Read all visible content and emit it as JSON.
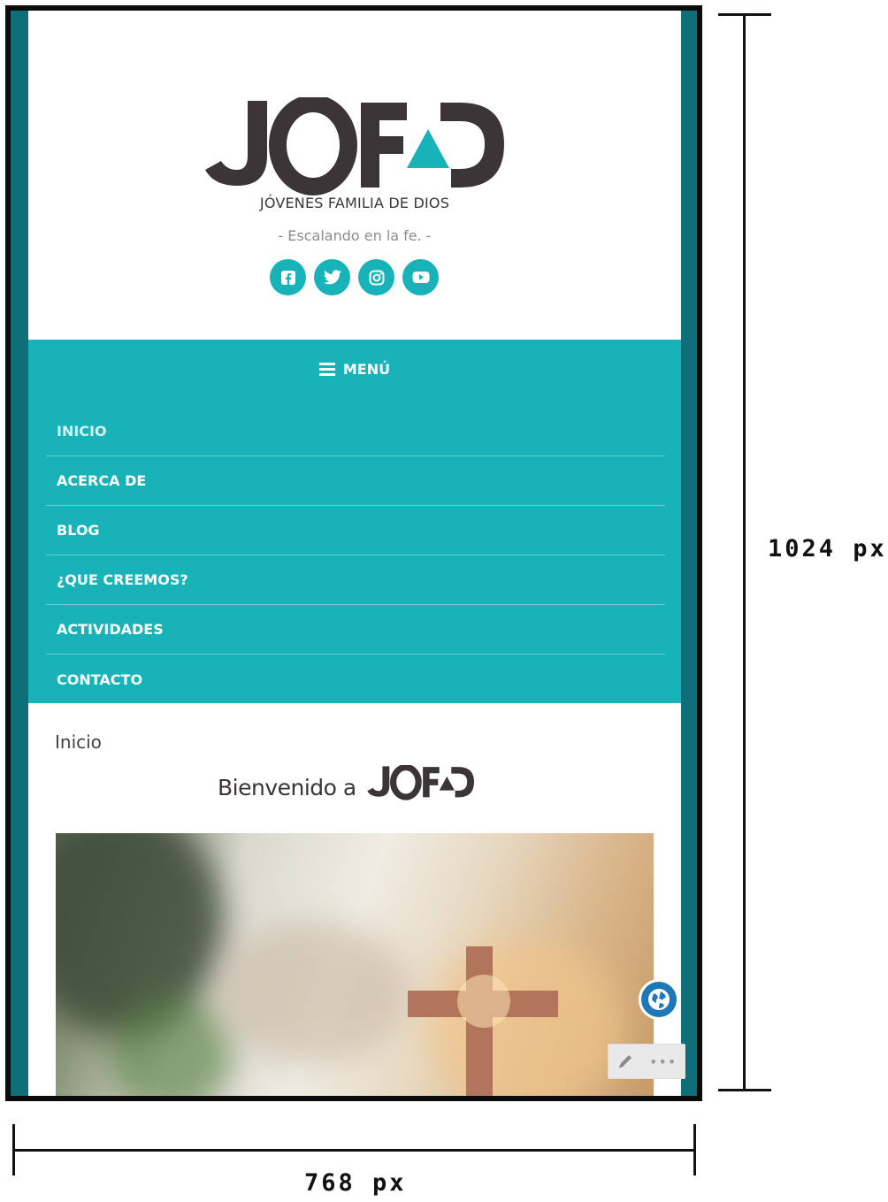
{
  "header": {
    "logo_text": "JOFAD",
    "logo_subtitle": "JÓVENES FAMILIA DE DIOS",
    "tagline": "- Escalando en la fe. -",
    "social": [
      {
        "icon": "facebook-icon"
      },
      {
        "icon": "twitter-icon"
      },
      {
        "icon": "instagram-icon"
      },
      {
        "icon": "youtube-icon"
      }
    ]
  },
  "nav": {
    "toggle_label": "MENÚ",
    "items": [
      {
        "label": "INICIO",
        "active": true
      },
      {
        "label": "ACERCA DE"
      },
      {
        "label": "BLOG"
      },
      {
        "label": "¿QUE CREEMOS?"
      },
      {
        "label": "ACTIVIDADES"
      },
      {
        "label": "CONTACTO"
      }
    ]
  },
  "content": {
    "breadcrumb": "Inicio",
    "welcome_text": "Bienvenido a",
    "welcome_logo": "JOFAD"
  },
  "annotations": {
    "height_label": "1024 px",
    "width_label": "768 px"
  },
  "colors": {
    "accent": "#17b3b9",
    "frame": "#0e6f78",
    "logo_dark": "#3b3537",
    "globe_button": "#1e78b5"
  }
}
